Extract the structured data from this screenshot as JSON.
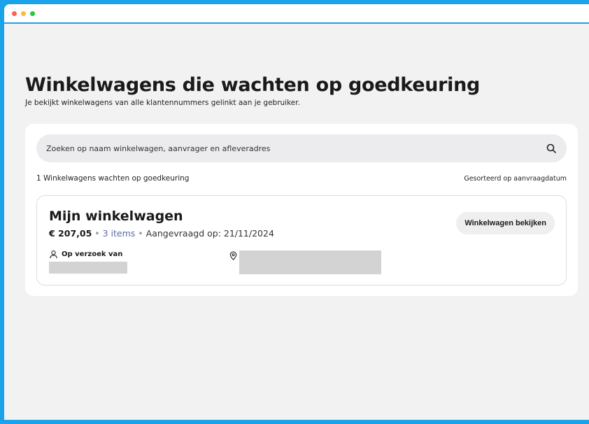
{
  "header": {
    "title": "Winkelwagens die wachten op goedkeuring",
    "subtitle": "Je bekijkt winkelwagens van alle klantennummers gelinkt aan je gebruiker."
  },
  "search": {
    "placeholder": "Zoeken op naam winkelwagen, aanvrager en afleveradres",
    "icon": "search-icon"
  },
  "results": {
    "count_text": "1 Winkelwagens wachten op goedkeuring",
    "sort_text": "Gesorteerd op aanvraagdatum"
  },
  "cart": {
    "name": "Mijn winkelwagen",
    "price": "€ 207,05",
    "sep1": " • ",
    "items": "3 items",
    "sep2": " • ",
    "requested": "Aangevraagd op: 21/11/2024",
    "requested_by_label": "Op verzoek van",
    "view_button": "Winkelwagen bekijken"
  },
  "colors": {
    "frame": "#1aa3e8",
    "page_bg": "#f2f2f3",
    "items_link": "#5a6aa6"
  }
}
